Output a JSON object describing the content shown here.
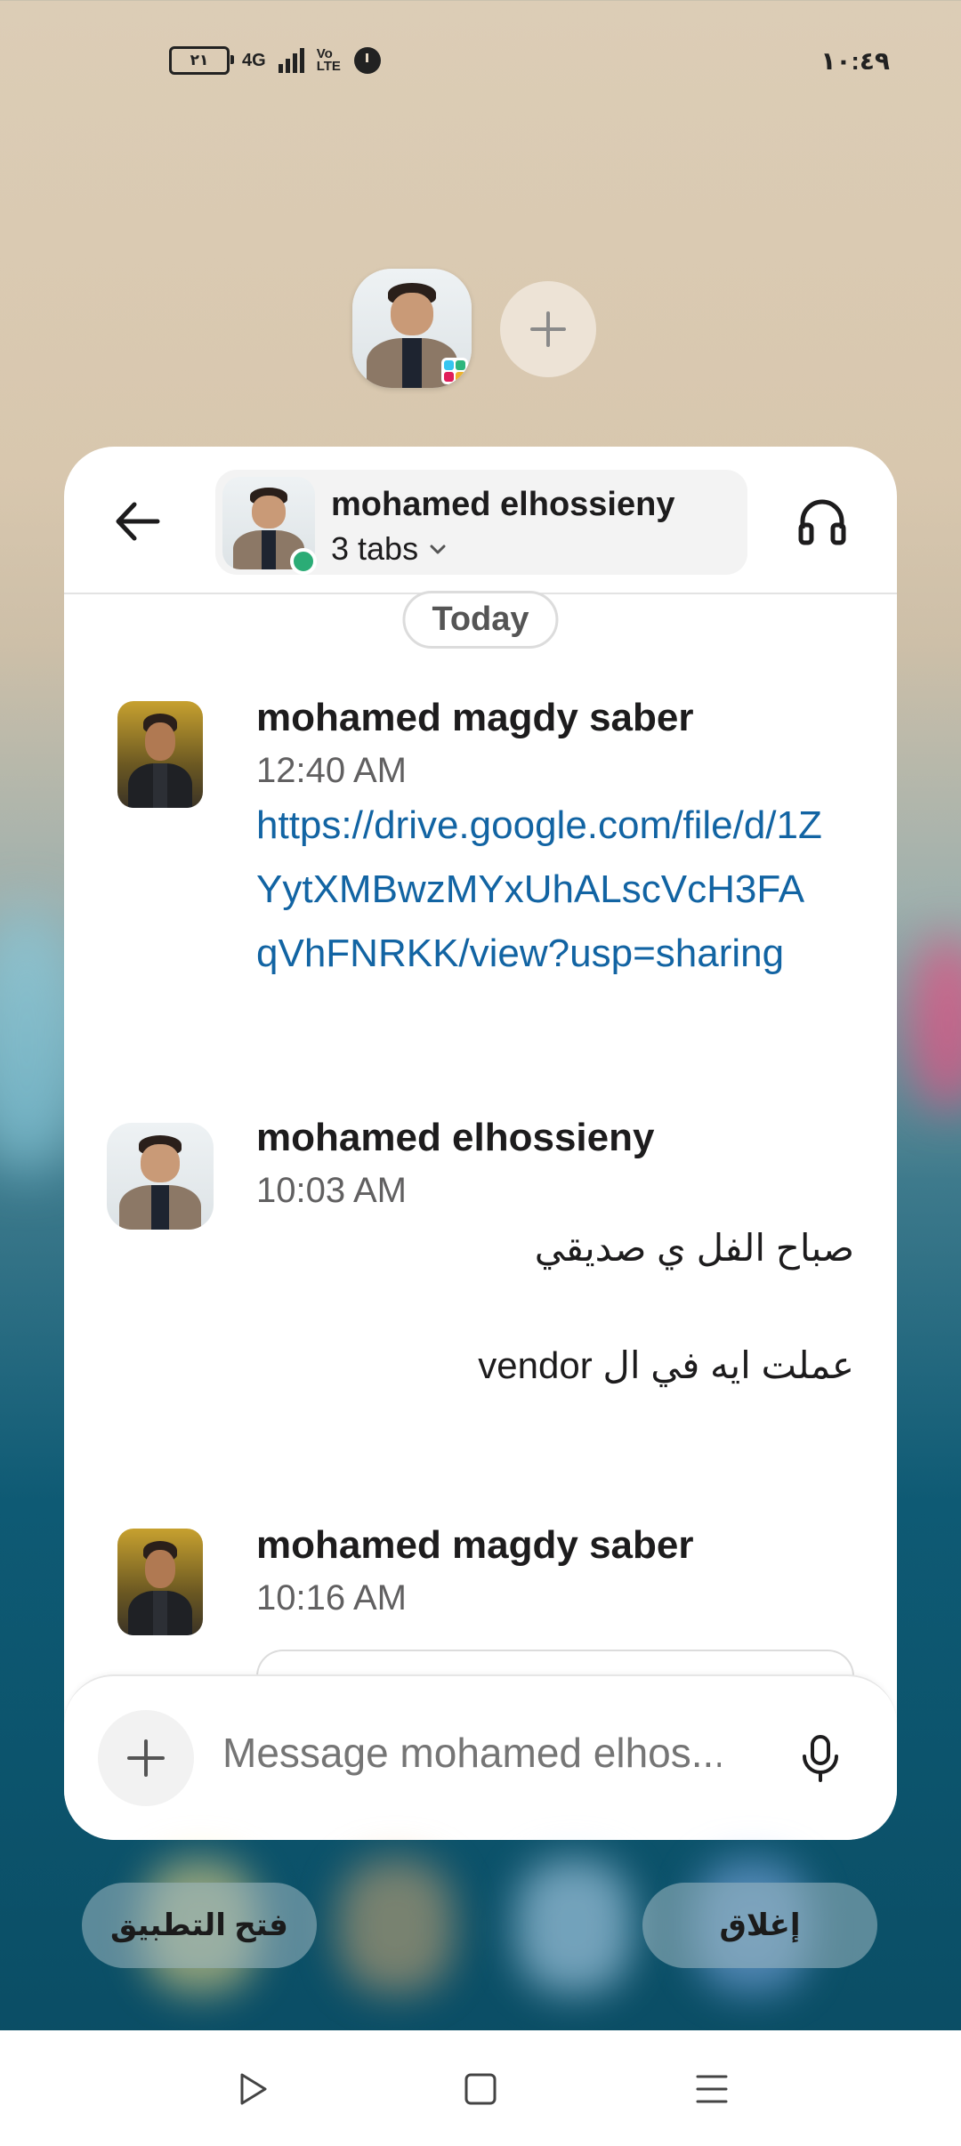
{
  "status_bar": {
    "battery": "٢١",
    "network": "4G",
    "volte": "Vo LTE",
    "time": "١٠:٤٩"
  },
  "chat_header": {
    "name": "mohamed elhossieny",
    "tabs_label": "3 tabs"
  },
  "date_divider": "Today",
  "messages": [
    {
      "author": "mohamed magdy saber",
      "time": "12:40 AM",
      "link": "https://drive.google.com/file/d/1ZYytXMBwzMYxUhALscVcH3FAqVhFNRKK/view?usp=sharing"
    },
    {
      "author": "mohamed elhossieny",
      "time": "10:03 AM",
      "lines": [
        "صباح الفل ي صديقي",
        "عملت ايه في ال  vendor"
      ]
    },
    {
      "author": "mohamed magdy saber",
      "time": "10:16 AM"
    }
  ],
  "composer": {
    "placeholder": "Message mohamed elhos..."
  },
  "bottom_actions": {
    "open_app": "فتح التطبيق",
    "close": "إغلاق"
  },
  "colors": {
    "link": "#1264a3",
    "presence": "#2bac76"
  }
}
